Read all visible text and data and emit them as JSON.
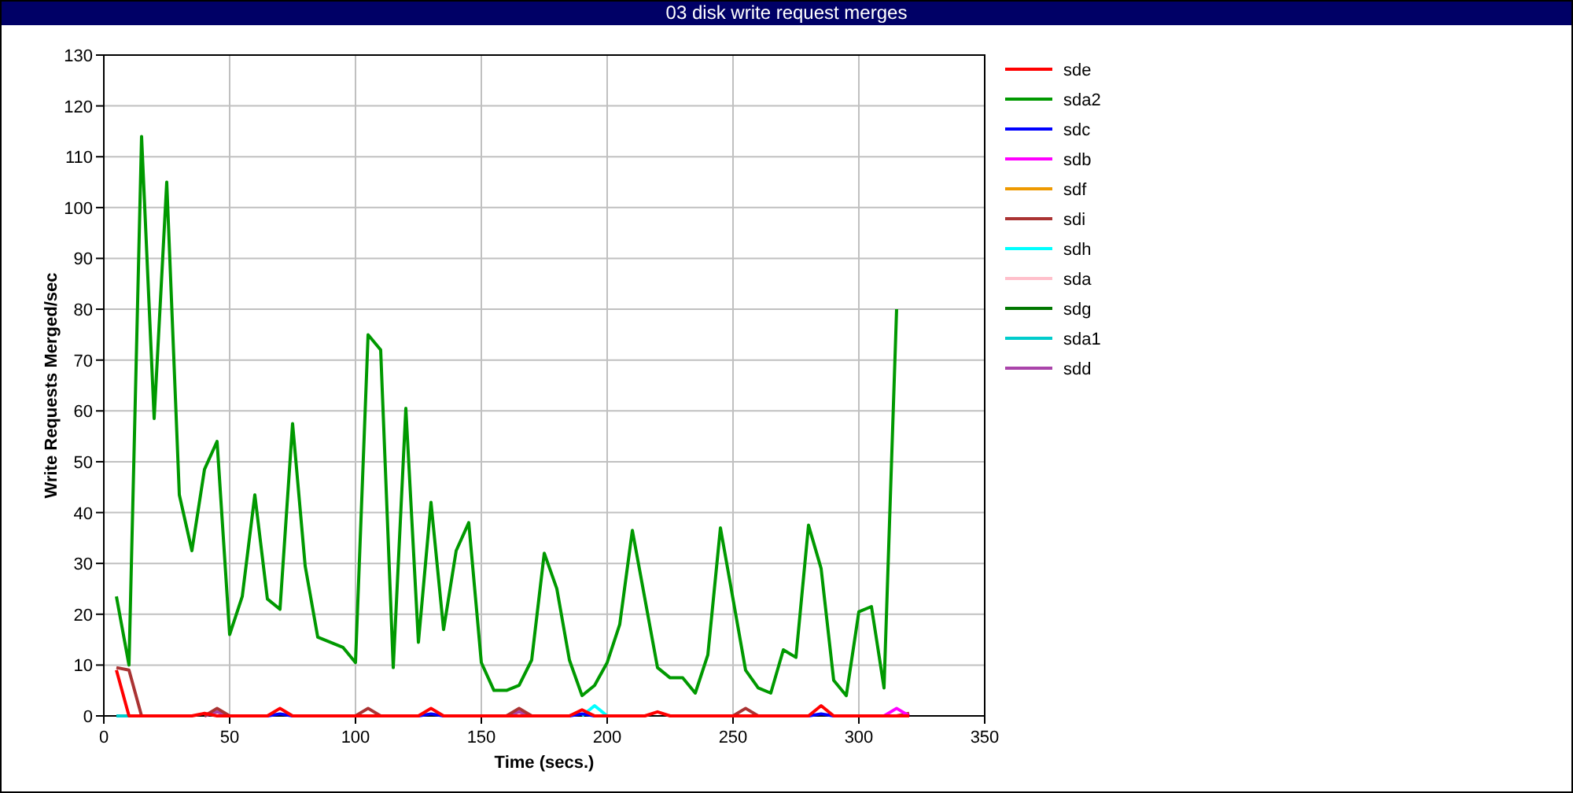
{
  "window": {
    "title": "03 disk write request merges"
  },
  "chart": {
    "chart_data": {
      "type": "line",
      "xlabel": "Time (secs.)",
      "ylabel": "Write Requests Merged/sec",
      "xlim": [
        0,
        350
      ],
      "ylim": [
        0,
        130
      ],
      "xticks": [
        0,
        50,
        100,
        150,
        200,
        250,
        300,
        350
      ],
      "yticks": [
        0,
        10,
        20,
        30,
        40,
        50,
        60,
        70,
        80,
        90,
        100,
        110,
        120,
        130
      ],
      "grid": true,
      "legend": "right",
      "x": [
        5,
        10,
        15,
        20,
        25,
        30,
        35,
        40,
        45,
        50,
        55,
        60,
        65,
        70,
        75,
        80,
        85,
        90,
        95,
        100,
        105,
        110,
        115,
        120,
        125,
        130,
        135,
        140,
        145,
        150,
        155,
        160,
        165,
        170,
        175,
        180,
        185,
        190,
        195,
        200,
        205,
        210,
        215,
        220,
        225,
        230,
        235,
        240,
        245,
        250,
        255,
        260,
        265,
        270,
        275,
        280,
        285,
        290,
        295,
        300,
        305,
        310,
        315,
        320
      ],
      "series": [
        {
          "name": "sde",
          "color": "#ff0000",
          "values": [
            9,
            0,
            0,
            0,
            0,
            0,
            0,
            0.5,
            0,
            0,
            0,
            0,
            0,
            1.5,
            0,
            0,
            0,
            0,
            0,
            0,
            0,
            0,
            0,
            0,
            0,
            1.5,
            0,
            0,
            0,
            0,
            0,
            0,
            0,
            0,
            0,
            0,
            0,
            1.2,
            0,
            0,
            0,
            0,
            0,
            0.8,
            0,
            0,
            0,
            0,
            0,
            0,
            0,
            0,
            0,
            0,
            0,
            0,
            2,
            0,
            0,
            0,
            0,
            0,
            0,
            0
          ]
        },
        {
          "name": "sda2",
          "color": "#009900",
          "values": [
            23.5,
            10,
            114,
            58.5,
            105,
            43.5,
            32.5,
            48.5,
            54,
            16,
            23.5,
            43.5,
            23,
            21,
            57.5,
            29.5,
            15.5,
            14.5,
            13.5,
            10.5,
            75,
            72,
            9.5,
            60.5,
            14.5,
            42,
            17,
            32.5,
            38,
            10.5,
            5,
            5,
            6,
            11,
            32,
            25,
            11,
            4,
            6,
            10.5,
            18,
            36.5,
            23,
            9.5,
            7.5,
            7.5,
            4.5,
            12,
            37,
            23,
            9,
            5.5,
            4.5,
            13,
            11.5,
            37.5,
            29,
            7,
            4,
            20.5,
            21.5,
            5.5,
            80,
            null
          ]
        },
        {
          "name": "sdc",
          "color": "#0000ff",
          "values": [
            null,
            null,
            null,
            null,
            null,
            null,
            null,
            null,
            null,
            null,
            null,
            null,
            0,
            0.4,
            0,
            null,
            null,
            null,
            null,
            null,
            null,
            null,
            null,
            null,
            0,
            0.4,
            0,
            null,
            null,
            null,
            null,
            null,
            null,
            null,
            null,
            null,
            0,
            0.4,
            0,
            null,
            null,
            null,
            null,
            null,
            null,
            null,
            null,
            null,
            null,
            null,
            null,
            null,
            null,
            null,
            null,
            0,
            0.4,
            0,
            null,
            null,
            null,
            null,
            null,
            null
          ]
        },
        {
          "name": "sdb",
          "color": "#ff00ff",
          "values": [
            null,
            null,
            null,
            null,
            null,
            null,
            null,
            null,
            null,
            null,
            null,
            null,
            null,
            null,
            null,
            null,
            null,
            null,
            null,
            null,
            null,
            null,
            null,
            null,
            null,
            null,
            null,
            null,
            null,
            null,
            null,
            null,
            null,
            null,
            null,
            null,
            null,
            null,
            null,
            null,
            null,
            null,
            null,
            null,
            null,
            null,
            null,
            null,
            null,
            null,
            null,
            null,
            null,
            null,
            null,
            null,
            null,
            null,
            null,
            null,
            null,
            0,
            1.5,
            0
          ]
        },
        {
          "name": "sdf",
          "color": "#ee9900",
          "values": [
            null,
            null,
            null,
            null,
            null,
            null,
            null,
            null,
            null,
            null,
            null,
            null,
            null,
            null,
            null,
            null,
            null,
            null,
            null,
            null,
            null,
            null,
            null,
            null,
            null,
            null,
            null,
            null,
            null,
            null,
            null,
            null,
            null,
            null,
            null,
            null,
            null,
            null,
            null,
            null,
            null,
            null,
            null,
            null,
            null,
            null,
            null,
            null,
            null,
            null,
            null,
            null,
            null,
            null,
            null,
            null,
            null,
            null,
            null,
            null,
            null,
            null,
            null,
            null
          ]
        },
        {
          "name": "sdi",
          "color": "#aa3333",
          "values": [
            9.5,
            9,
            0,
            null,
            null,
            null,
            null,
            0,
            1.5,
            0,
            null,
            null,
            null,
            null,
            null,
            null,
            null,
            null,
            null,
            0,
            1.5,
            0,
            null,
            null,
            null,
            null,
            null,
            null,
            null,
            null,
            null,
            0,
            1.5,
            0,
            null,
            null,
            null,
            null,
            null,
            null,
            null,
            null,
            null,
            null,
            null,
            null,
            null,
            null,
            null,
            0,
            1.5,
            0,
            null,
            null,
            null,
            null,
            null,
            null,
            null,
            null,
            null,
            null,
            0,
            0.5
          ]
        },
        {
          "name": "sdh",
          "color": "#00ffff",
          "values": [
            null,
            null,
            null,
            null,
            null,
            null,
            null,
            null,
            null,
            null,
            null,
            null,
            null,
            null,
            null,
            null,
            null,
            null,
            null,
            null,
            null,
            null,
            null,
            null,
            null,
            null,
            null,
            null,
            null,
            null,
            null,
            null,
            null,
            null,
            null,
            null,
            null,
            0,
            2,
            0,
            null,
            null,
            null,
            null,
            null,
            null,
            null,
            null,
            null,
            null,
            null,
            null,
            null,
            null,
            null,
            null,
            null,
            null,
            null,
            null,
            null,
            null,
            null,
            null
          ]
        },
        {
          "name": "sda",
          "color": "#ffc0cb",
          "values": [
            null,
            null,
            null,
            null,
            null,
            null,
            null,
            null,
            null,
            null,
            null,
            null,
            null,
            null,
            null,
            null,
            null,
            null,
            null,
            null,
            null,
            null,
            null,
            null,
            null,
            null,
            null,
            null,
            null,
            null,
            null,
            null,
            null,
            null,
            null,
            null,
            null,
            null,
            null,
            null,
            null,
            null,
            null,
            null,
            null,
            null,
            null,
            null,
            null,
            null,
            null,
            null,
            null,
            null,
            null,
            null,
            null,
            null,
            null,
            null,
            null,
            null,
            null,
            null
          ]
        },
        {
          "name": "sdg",
          "color": "#007700",
          "values": [
            null,
            null,
            null,
            null,
            null,
            null,
            null,
            null,
            null,
            null,
            null,
            null,
            null,
            null,
            null,
            null,
            null,
            null,
            null,
            null,
            null,
            null,
            null,
            null,
            null,
            null,
            null,
            null,
            null,
            null,
            null,
            null,
            null,
            null,
            null,
            null,
            null,
            null,
            null,
            null,
            null,
            null,
            null,
            null,
            null,
            null,
            null,
            null,
            null,
            null,
            null,
            null,
            null,
            null,
            null,
            null,
            null,
            null,
            null,
            null,
            null,
            null,
            null,
            null
          ]
        },
        {
          "name": "sda1",
          "color": "#00cccc",
          "values": [
            0,
            0,
            null,
            null,
            null,
            null,
            null,
            null,
            null,
            null,
            null,
            null,
            null,
            null,
            null,
            null,
            null,
            null,
            null,
            null,
            null,
            null,
            null,
            null,
            null,
            null,
            null,
            null,
            null,
            null,
            null,
            null,
            null,
            null,
            null,
            null,
            null,
            null,
            null,
            null,
            null,
            null,
            null,
            null,
            null,
            null,
            null,
            null,
            null,
            null,
            null,
            null,
            null,
            null,
            null,
            null,
            null,
            null,
            null,
            null,
            null,
            null,
            null,
            null
          ]
        },
        {
          "name": "sdd",
          "color": "#aa44aa",
          "values": [
            null,
            null,
            null,
            null,
            null,
            null,
            null,
            0,
            0.8,
            0,
            null,
            null,
            null,
            null,
            null,
            null,
            null,
            null,
            null,
            null,
            null,
            null,
            null,
            null,
            null,
            null,
            null,
            null,
            null,
            null,
            null,
            0,
            0.8,
            0,
            null,
            null,
            null,
            null,
            null,
            null,
            null,
            null,
            null,
            null,
            null,
            null,
            null,
            null,
            null,
            null,
            null,
            null,
            null,
            null,
            null,
            null,
            null,
            null,
            null,
            null,
            null,
            null,
            null,
            null
          ]
        }
      ]
    }
  }
}
